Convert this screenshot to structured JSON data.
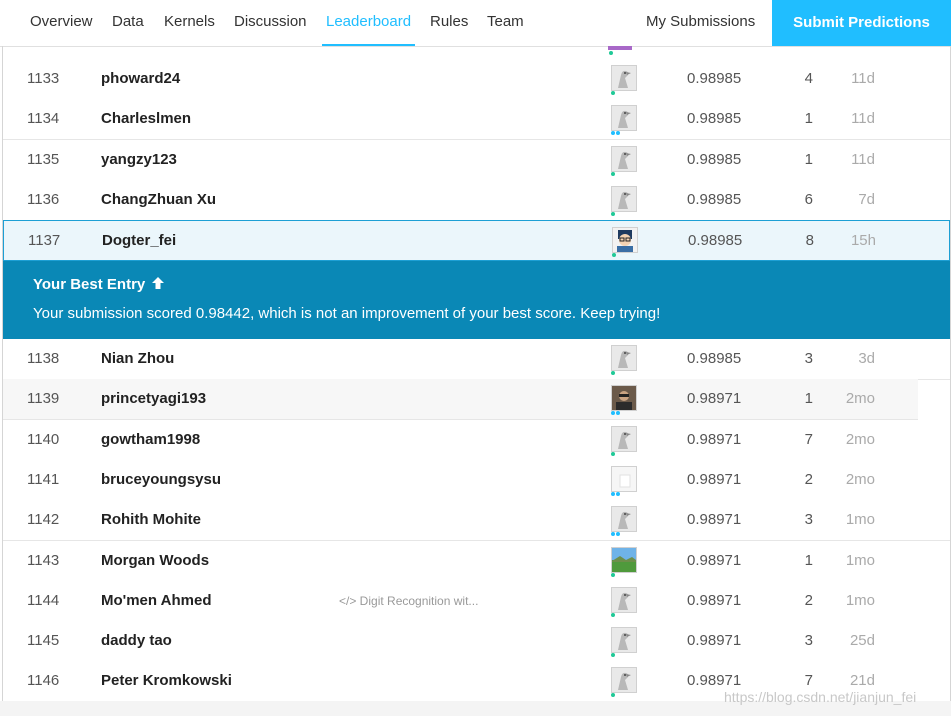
{
  "tabs": [
    {
      "label": "Overview",
      "active": false
    },
    {
      "label": "Data",
      "active": false
    },
    {
      "label": "Kernels",
      "active": false
    },
    {
      "label": "Discussion",
      "active": false
    },
    {
      "label": "Leaderboard",
      "active": true
    },
    {
      "label": "Rules",
      "active": false
    },
    {
      "label": "Team",
      "active": false
    }
  ],
  "my_submissions": "My Submissions",
  "submit_label": "Submit Predictions",
  "colors": {
    "accent": "#20beff",
    "banner": "#0a88b6",
    "highlight_row": "#ebf6fb"
  },
  "rows": [
    {
      "rank": "1133",
      "name": "phoward24",
      "kernel": "",
      "score": "0.98985",
      "entries": "4",
      "last": "11d",
      "avatar": "goose-icon",
      "dots": [
        "t"
      ]
    },
    {
      "rank": "1134",
      "name": "Charleslmen",
      "kernel": "",
      "score": "0.98985",
      "entries": "1",
      "last": "11d",
      "avatar": "goose-icon",
      "dots": [
        "b",
        "b"
      ]
    },
    {
      "rank": "1135",
      "name": "yangzy123",
      "kernel": "",
      "score": "0.98985",
      "entries": "1",
      "last": "11d",
      "avatar": "goose-icon",
      "dots": [
        "t"
      ]
    },
    {
      "rank": "1136",
      "name": "ChangZhuan Xu",
      "kernel": "",
      "score": "0.98985",
      "entries": "6",
      "last": "7d",
      "avatar": "goose-icon",
      "dots": [
        "t"
      ]
    },
    {
      "rank": "1137",
      "name": "Dogter_fei",
      "kernel": "",
      "score": "0.98985",
      "entries": "8",
      "last": "15h",
      "avatar": "cartoon-avatar-icon",
      "dots": [
        "t"
      ],
      "you": true
    }
  ],
  "banner": {
    "title": "Your Best Entry",
    "title_icon": "arrow-up-icon",
    "message": "Your submission scored 0.98442, which is not an improvement of your best score. Keep trying!"
  },
  "rows_after": [
    {
      "rank": "1138",
      "name": "Nian Zhou",
      "kernel": "",
      "score": "0.98985",
      "entries": "3",
      "last": "3d",
      "avatar": "goose-icon",
      "dots": [
        "t"
      ]
    },
    {
      "rank": "1139",
      "name": "princetyagi193",
      "kernel": "",
      "score": "0.98971",
      "entries": "1",
      "last": "2mo",
      "avatar": "photo-avatar-icon",
      "dots": [
        "b",
        "b"
      ],
      "shade": true
    },
    {
      "rank": "1140",
      "name": "gowtham1998",
      "kernel": "",
      "score": "0.98971",
      "entries": "7",
      "last": "2mo",
      "avatar": "goose-icon",
      "dots": [
        "t"
      ]
    },
    {
      "rank": "1141",
      "name": "bruceyoungsysu",
      "kernel": "",
      "score": "0.98971",
      "entries": "2",
      "last": "2mo",
      "avatar": "blank-avatar-icon",
      "dots": [
        "b",
        "b"
      ]
    },
    {
      "rank": "1142",
      "name": "Rohith Mohite",
      "kernel": "",
      "score": "0.98971",
      "entries": "3",
      "last": "1mo",
      "avatar": "goose-icon",
      "dots": [
        "b",
        "b"
      ]
    },
    {
      "rank": "1143",
      "name": "Morgan Woods",
      "kernel": "",
      "score": "0.98971",
      "entries": "1",
      "last": "1mo",
      "avatar": "landscape-avatar-icon",
      "dots": [
        "t"
      ]
    },
    {
      "rank": "1144",
      "name": "Mo'men Ahmed",
      "kernel": "</> Digit Recognition wit...",
      "score": "0.98971",
      "entries": "2",
      "last": "1mo",
      "avatar": "goose-icon",
      "dots": [
        "t"
      ]
    },
    {
      "rank": "1145",
      "name": "daddy tao",
      "kernel": "",
      "score": "0.98971",
      "entries": "3",
      "last": "25d",
      "avatar": "goose-icon",
      "dots": [
        "t"
      ]
    },
    {
      "rank": "1146",
      "name": "Peter Kromkowski",
      "kernel": "",
      "score": "0.98971",
      "entries": "7",
      "last": "21d",
      "avatar": "goose-icon",
      "dots": [
        "t"
      ]
    }
  ],
  "watermark": "https://blog.csdn.net/jianjun_fei"
}
